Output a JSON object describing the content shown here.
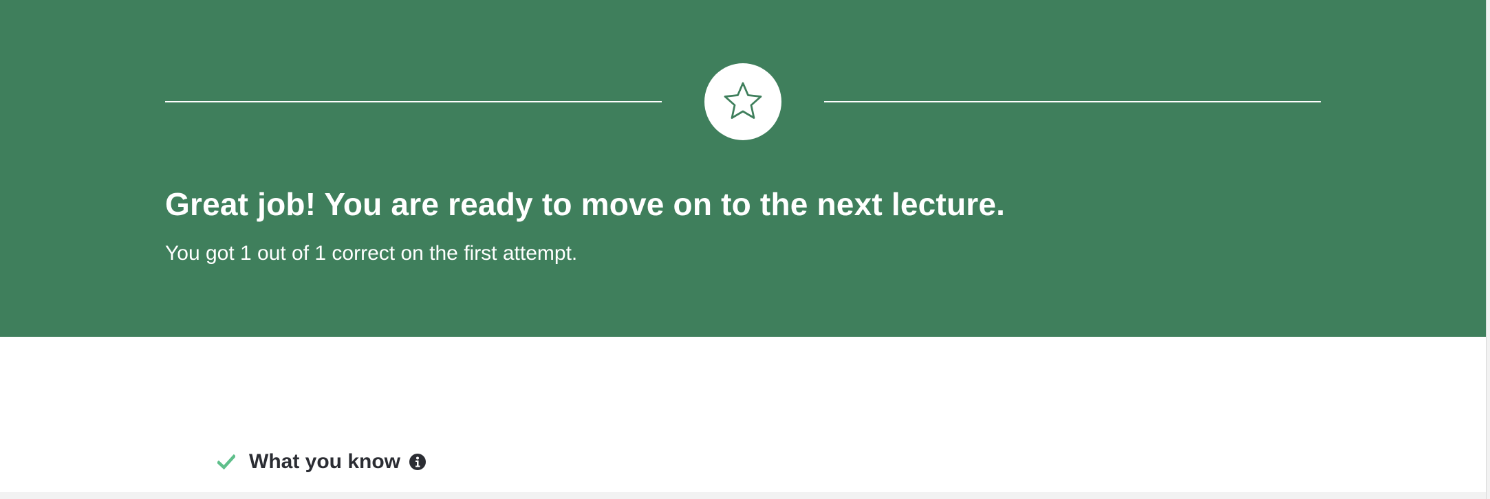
{
  "hero": {
    "background_color": "#3f7f5c",
    "star_icon": "star-icon",
    "headline": "Great job! You are ready to move on to the next lecture.",
    "subline": "You got 1 out of 1 correct on the first attempt."
  },
  "knowledge": {
    "check_icon": "check-icon",
    "check_color": "#5fbf8b",
    "title": "What you know",
    "info_icon": "info-icon"
  }
}
